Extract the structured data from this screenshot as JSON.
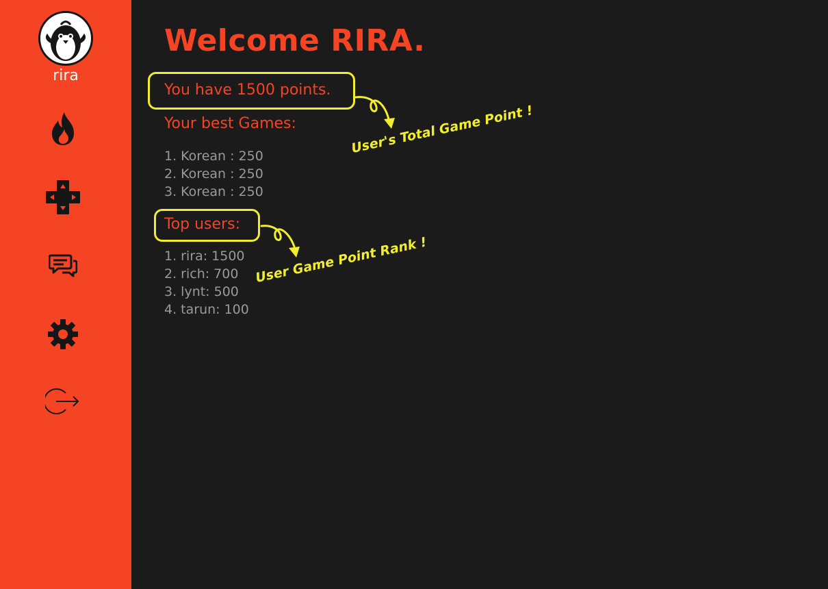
{
  "sidebar": {
    "username": "rira",
    "items": [
      {
        "name": "trending",
        "icon": "flame-icon"
      },
      {
        "name": "games",
        "icon": "dpad-icon"
      },
      {
        "name": "chat",
        "icon": "chat-bubbles-icon"
      },
      {
        "name": "settings",
        "icon": "gear-icon"
      },
      {
        "name": "logout",
        "icon": "logout-icon"
      }
    ]
  },
  "main": {
    "title": "Welcome RIRA.",
    "points_text": "You have 1500 points.",
    "best_games_title": "Your best Games:",
    "best_games": [
      "1. Korean : 250",
      "2. Korean : 250",
      "3. Korean : 250"
    ],
    "top_users_title": "Top users:",
    "top_users": [
      "1. rira: 1500",
      "2. rich: 700",
      "3. lynt: 500",
      "4. tarun: 100"
    ]
  },
  "annotations": {
    "total_points_note": "User's Total Game Point !",
    "rank_note": "User Game Point Rank !"
  },
  "colors": {
    "accent": "#f44424",
    "background": "#1b1b1b",
    "annotation": "#f2ee2d",
    "muted_text": "#9a9a9a"
  }
}
